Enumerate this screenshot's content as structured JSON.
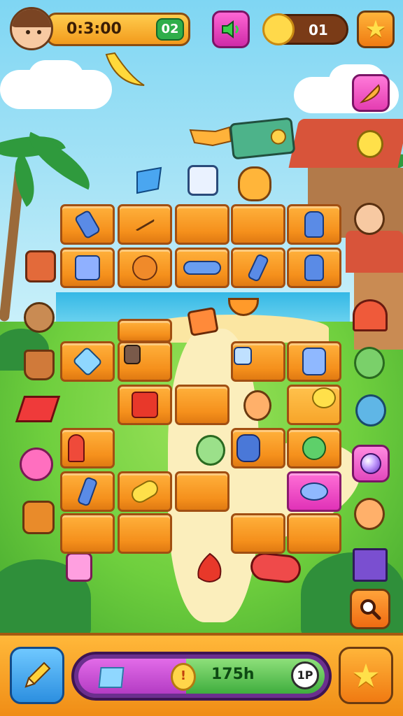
{
  "hud": {
    "timer": "0:3:00",
    "timer_badge": "02",
    "coins": "01"
  },
  "icons": {
    "sound": "speaker-icon",
    "star_top": "star-icon",
    "side_1": "feather-icon",
    "side_2": "orb-icon",
    "search": "magnifier-icon",
    "pencil": "pencil-icon",
    "star_bottom": "star-icon"
  },
  "progress": {
    "coin_label": "!",
    "value_text": "175h",
    "badge": "1P"
  },
  "colors": {
    "tile_orange": "#f5901c",
    "tile_pink": "#e032b7",
    "accent_green": "#3fae3e",
    "accent_purple": "#b43cc4"
  },
  "board": {
    "items": [
      "bottle",
      "arrow",
      "",
      "",
      "glove",
      "dice",
      "orange",
      "cylinder",
      "bottle",
      "glove",
      "",
      "",
      "",
      "",
      "",
      "gem",
      "bag",
      "dice",
      "",
      "cup",
      "",
      "red-dice",
      "",
      "character",
      "",
      "cane",
      "",
      "character",
      "vase",
      "hammer",
      "bottle",
      "candy",
      "",
      "",
      "fish"
    ]
  }
}
